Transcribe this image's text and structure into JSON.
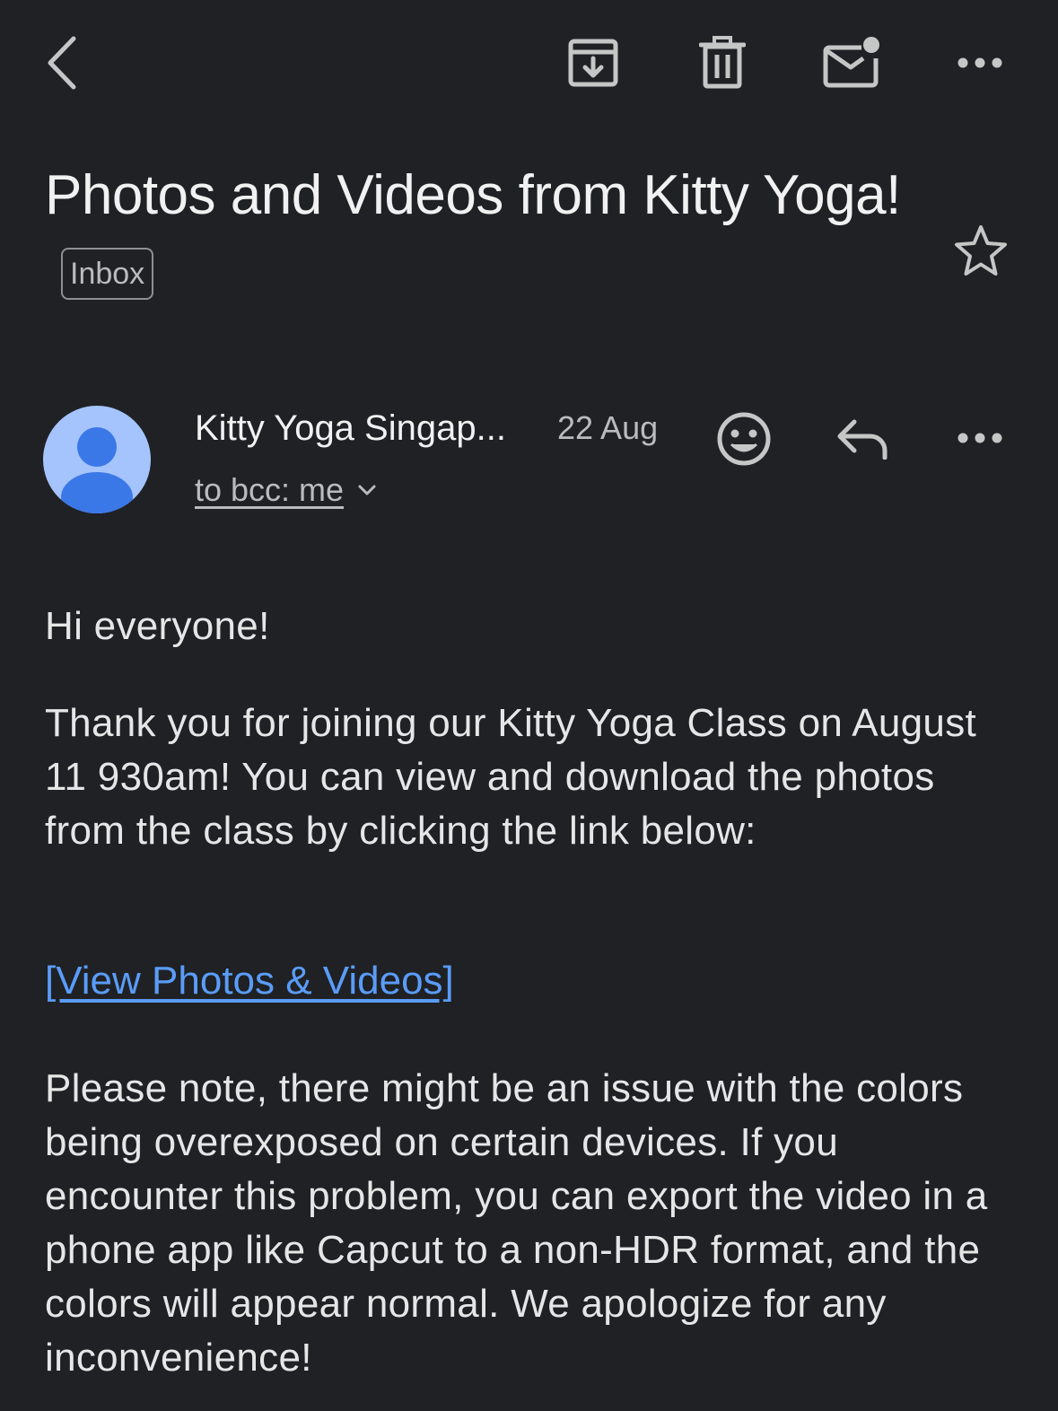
{
  "toolbar": {
    "back_icon": "back-arrow-icon",
    "archive_icon": "archive-icon",
    "delete_icon": "trash-icon",
    "mark_unread_icon": "mark-unread-icon",
    "more_icon": "more-icon"
  },
  "email": {
    "subject": "Photos and Videos from Kitty Yoga!",
    "label": "Inbox",
    "starred": false,
    "sender": {
      "name": "Kitty Yoga Singap...",
      "date": "22 Aug",
      "recipients": "to bcc: me"
    },
    "body": {
      "greeting": "Hi everyone!",
      "paragraph1": "Thank you for joining our Kitty Yoga Class on August 11 930am! You can view and download the photos from the class by clicking the link below:",
      "link_text": "[View Photos & Videos]",
      "paragraph2": "Please note, there might be an issue with the colors being overexposed on certain devices. If you encounter this problem, you can export the video in a phone app like Capcut to a non-HDR format, and the colors will appear normal. We apologize for any inconvenience!"
    }
  },
  "colors": {
    "background": "#1f2125",
    "text": "#e6e6e6",
    "secondary_text": "#b9bbbe",
    "link": "#5a9cf8",
    "avatar_bg": "#a5c4fd",
    "avatar_fg": "#3b78e7"
  }
}
